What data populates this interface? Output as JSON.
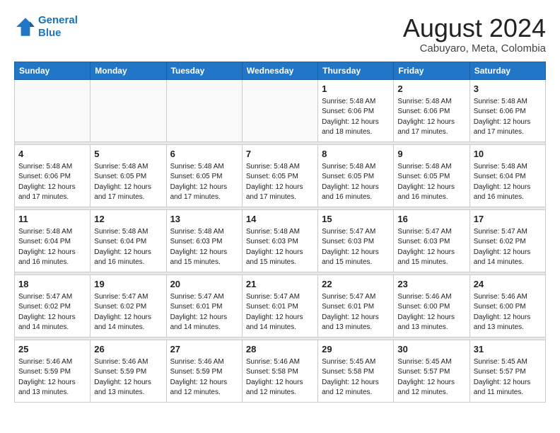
{
  "header": {
    "logo_line1": "General",
    "logo_line2": "Blue",
    "month": "August 2024",
    "location": "Cabuyaro, Meta, Colombia"
  },
  "weekdays": [
    "Sunday",
    "Monday",
    "Tuesday",
    "Wednesday",
    "Thursday",
    "Friday",
    "Saturday"
  ],
  "weeks": [
    [
      {
        "day": "",
        "info": ""
      },
      {
        "day": "",
        "info": ""
      },
      {
        "day": "",
        "info": ""
      },
      {
        "day": "",
        "info": ""
      },
      {
        "day": "1",
        "info": "Sunrise: 5:48 AM\nSunset: 6:06 PM\nDaylight: 12 hours\nand 18 minutes."
      },
      {
        "day": "2",
        "info": "Sunrise: 5:48 AM\nSunset: 6:06 PM\nDaylight: 12 hours\nand 17 minutes."
      },
      {
        "day": "3",
        "info": "Sunrise: 5:48 AM\nSunset: 6:06 PM\nDaylight: 12 hours\nand 17 minutes."
      }
    ],
    [
      {
        "day": "4",
        "info": "Sunrise: 5:48 AM\nSunset: 6:06 PM\nDaylight: 12 hours\nand 17 minutes."
      },
      {
        "day": "5",
        "info": "Sunrise: 5:48 AM\nSunset: 6:05 PM\nDaylight: 12 hours\nand 17 minutes."
      },
      {
        "day": "6",
        "info": "Sunrise: 5:48 AM\nSunset: 6:05 PM\nDaylight: 12 hours\nand 17 minutes."
      },
      {
        "day": "7",
        "info": "Sunrise: 5:48 AM\nSunset: 6:05 PM\nDaylight: 12 hours\nand 17 minutes."
      },
      {
        "day": "8",
        "info": "Sunrise: 5:48 AM\nSunset: 6:05 PM\nDaylight: 12 hours\nand 16 minutes."
      },
      {
        "day": "9",
        "info": "Sunrise: 5:48 AM\nSunset: 6:05 PM\nDaylight: 12 hours\nand 16 minutes."
      },
      {
        "day": "10",
        "info": "Sunrise: 5:48 AM\nSunset: 6:04 PM\nDaylight: 12 hours\nand 16 minutes."
      }
    ],
    [
      {
        "day": "11",
        "info": "Sunrise: 5:48 AM\nSunset: 6:04 PM\nDaylight: 12 hours\nand 16 minutes."
      },
      {
        "day": "12",
        "info": "Sunrise: 5:48 AM\nSunset: 6:04 PM\nDaylight: 12 hours\nand 16 minutes."
      },
      {
        "day": "13",
        "info": "Sunrise: 5:48 AM\nSunset: 6:03 PM\nDaylight: 12 hours\nand 15 minutes."
      },
      {
        "day": "14",
        "info": "Sunrise: 5:48 AM\nSunset: 6:03 PM\nDaylight: 12 hours\nand 15 minutes."
      },
      {
        "day": "15",
        "info": "Sunrise: 5:47 AM\nSunset: 6:03 PM\nDaylight: 12 hours\nand 15 minutes."
      },
      {
        "day": "16",
        "info": "Sunrise: 5:47 AM\nSunset: 6:03 PM\nDaylight: 12 hours\nand 15 minutes."
      },
      {
        "day": "17",
        "info": "Sunrise: 5:47 AM\nSunset: 6:02 PM\nDaylight: 12 hours\nand 14 minutes."
      }
    ],
    [
      {
        "day": "18",
        "info": "Sunrise: 5:47 AM\nSunset: 6:02 PM\nDaylight: 12 hours\nand 14 minutes."
      },
      {
        "day": "19",
        "info": "Sunrise: 5:47 AM\nSunset: 6:02 PM\nDaylight: 12 hours\nand 14 minutes."
      },
      {
        "day": "20",
        "info": "Sunrise: 5:47 AM\nSunset: 6:01 PM\nDaylight: 12 hours\nand 14 minutes."
      },
      {
        "day": "21",
        "info": "Sunrise: 5:47 AM\nSunset: 6:01 PM\nDaylight: 12 hours\nand 14 minutes."
      },
      {
        "day": "22",
        "info": "Sunrise: 5:47 AM\nSunset: 6:01 PM\nDaylight: 12 hours\nand 13 minutes."
      },
      {
        "day": "23",
        "info": "Sunrise: 5:46 AM\nSunset: 6:00 PM\nDaylight: 12 hours\nand 13 minutes."
      },
      {
        "day": "24",
        "info": "Sunrise: 5:46 AM\nSunset: 6:00 PM\nDaylight: 12 hours\nand 13 minutes."
      }
    ],
    [
      {
        "day": "25",
        "info": "Sunrise: 5:46 AM\nSunset: 5:59 PM\nDaylight: 12 hours\nand 13 minutes."
      },
      {
        "day": "26",
        "info": "Sunrise: 5:46 AM\nSunset: 5:59 PM\nDaylight: 12 hours\nand 13 minutes."
      },
      {
        "day": "27",
        "info": "Sunrise: 5:46 AM\nSunset: 5:59 PM\nDaylight: 12 hours\nand 12 minutes."
      },
      {
        "day": "28",
        "info": "Sunrise: 5:46 AM\nSunset: 5:58 PM\nDaylight: 12 hours\nand 12 minutes."
      },
      {
        "day": "29",
        "info": "Sunrise: 5:45 AM\nSunset: 5:58 PM\nDaylight: 12 hours\nand 12 minutes."
      },
      {
        "day": "30",
        "info": "Sunrise: 5:45 AM\nSunset: 5:57 PM\nDaylight: 12 hours\nand 12 minutes."
      },
      {
        "day": "31",
        "info": "Sunrise: 5:45 AM\nSunset: 5:57 PM\nDaylight: 12 hours\nand 11 minutes."
      }
    ]
  ]
}
